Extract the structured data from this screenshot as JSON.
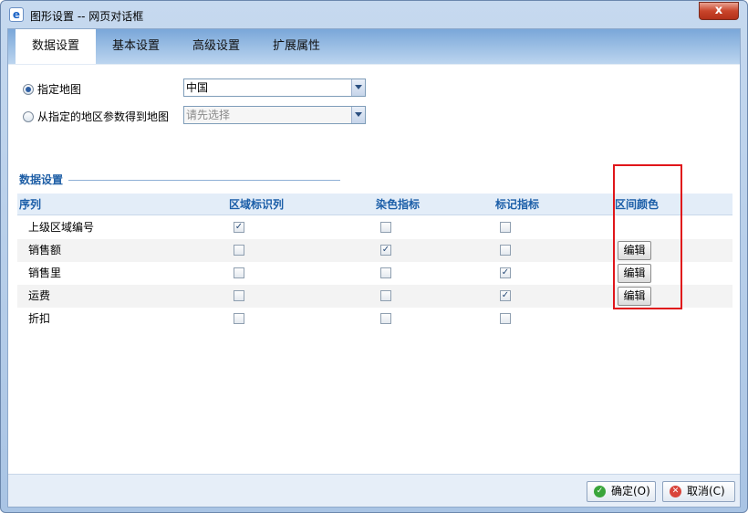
{
  "window": {
    "title": "图形设置 -- 网页对话框",
    "title_icon": "ie-page-icon",
    "close_label": "x"
  },
  "tabs": [
    {
      "label": "数据设置",
      "active": true
    },
    {
      "label": "基本设置",
      "active": false
    },
    {
      "label": "高级设置",
      "active": false
    },
    {
      "label": "扩展属性",
      "active": false
    }
  ],
  "map": {
    "option_specified": {
      "label": "指定地图",
      "selected": true
    },
    "option_from_param": {
      "label": "从指定的地区参数得到地图",
      "selected": false
    },
    "map_select_value": "中国",
    "param_select_placeholder": "请先选择"
  },
  "data_settings": {
    "section_title": "数据设置",
    "columns": [
      "序列",
      "区域标识列",
      "染色指标",
      "标记指标",
      "区间颜色"
    ],
    "edit_label": "编辑",
    "rows": [
      {
        "name": "上级区域编号",
        "region_id": true,
        "color_metric": false,
        "mark_metric": false,
        "has_edit": false
      },
      {
        "name": "销售额",
        "region_id": false,
        "color_metric": true,
        "mark_metric": false,
        "has_edit": true
      },
      {
        "name": "销售里",
        "region_id": false,
        "color_metric": false,
        "mark_metric": true,
        "has_edit": true
      },
      {
        "name": "运费",
        "region_id": false,
        "color_metric": false,
        "mark_metric": true,
        "has_edit": true
      },
      {
        "name": "折扣",
        "region_id": false,
        "color_metric": false,
        "mark_metric": false,
        "has_edit": false
      }
    ]
  },
  "footer": {
    "ok_label": "确定(O)",
    "cancel_label": "取消(C)"
  },
  "colors": {
    "accent": "#1b5ea8",
    "highlight_box": "#e0161b"
  }
}
